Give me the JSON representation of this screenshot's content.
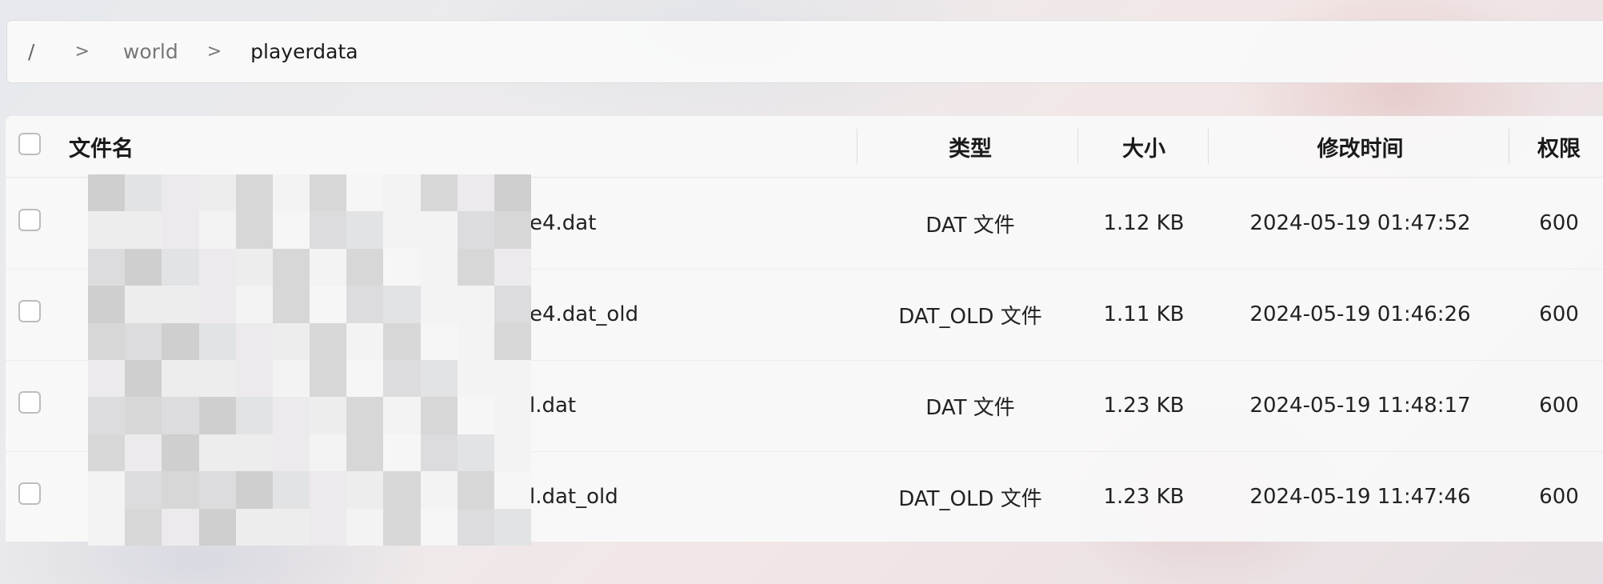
{
  "breadcrumb": {
    "root": "/",
    "separator": ">",
    "parent": "world",
    "current": "playerdata"
  },
  "table": {
    "columns": {
      "name": "文件名",
      "type": "类型",
      "size": "大小",
      "modified": "修改时间",
      "permissions": "权限"
    },
    "rows": [
      {
        "name_visible": "e4.dat",
        "type": "DAT 文件",
        "size": "1.12 KB",
        "modified": "2024-05-19 01:47:52",
        "perm": "600"
      },
      {
        "name_visible": "e4.dat_old",
        "type": "DAT_OLD 文件",
        "size": "1.11 KB",
        "modified": "2024-05-19 01:46:26",
        "perm": "600"
      },
      {
        "name_visible": "l.dat",
        "type": "DAT 文件",
        "size": "1.23 KB",
        "modified": "2024-05-19 11:48:17",
        "perm": "600"
      },
      {
        "name_visible": "l.dat_old",
        "type": "DAT_OLD 文件",
        "size": "1.23 KB",
        "modified": "2024-05-19 11:47:46",
        "perm": "600"
      }
    ]
  },
  "colors": {
    "panel": "#fafafa",
    "text": "#1c1c1c",
    "muted": "#777777",
    "checkbox_border": "#bdbdbd"
  }
}
